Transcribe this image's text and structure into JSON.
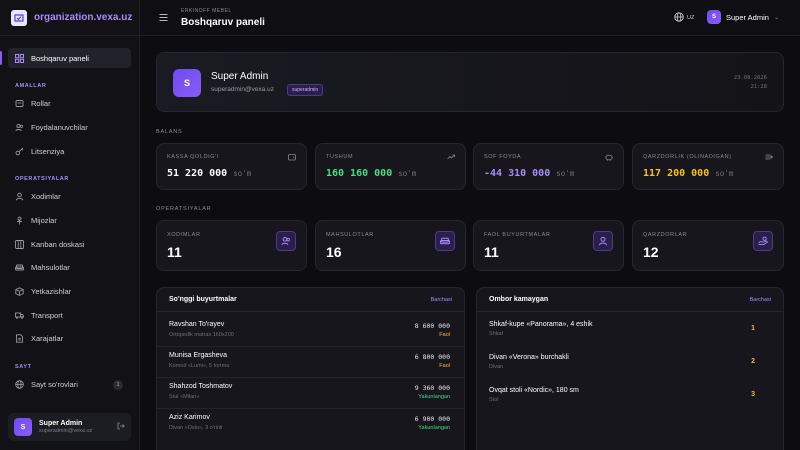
{
  "colors": {
    "accent": "#8b5cf6",
    "green": "#4ade80",
    "purple": "#a78bfa",
    "amber": "#fbbf24"
  },
  "brand": {
    "name": "organization.vexa.uz",
    "icon": "checkmark-shield-icon"
  },
  "sidebar": {
    "dashboard": {
      "label": "Boshqaruv paneli",
      "icon": "dashboard-grid-icon"
    },
    "sections": [
      {
        "title": "AMALLAR",
        "items": [
          {
            "label": "Rollar",
            "icon": "badge-icon"
          },
          {
            "label": "Foydalanuvchilar",
            "icon": "users-icon"
          },
          {
            "label": "Litsenziya",
            "icon": "key-icon"
          }
        ]
      },
      {
        "title": "OPERATSIYALAR",
        "items": [
          {
            "label": "Xodimlar",
            "icon": "user-icon"
          },
          {
            "label": "Mijozlar",
            "icon": "person-icon"
          },
          {
            "label": "Kanban doskasi",
            "icon": "kanban-icon"
          },
          {
            "label": "Mahsulotlar",
            "icon": "sofa-icon"
          },
          {
            "label": "Yetkazishlar",
            "icon": "box-icon"
          },
          {
            "label": "Transport",
            "icon": "truck-icon"
          },
          {
            "label": "Xarajatlar",
            "icon": "document-icon"
          }
        ]
      },
      {
        "title": "SAYT",
        "items": [
          {
            "label": "Sayt so'rovlari",
            "icon": "globe-icon",
            "badge": "1"
          }
        ]
      }
    ],
    "user": {
      "initial": "S",
      "name": "Super Admin",
      "email": "superadmin@vexa.uz"
    }
  },
  "header": {
    "subtitle": "ERKINOFF MEBEL",
    "title": "Boshqaruv paneli",
    "language": "UZ",
    "user": {
      "initial": "S",
      "name": "Super Admin"
    }
  },
  "profile": {
    "initial": "S",
    "name": "Super Admin",
    "email": "superadmin@vexa.uz",
    "role": "superadmin",
    "date": "23.08.2026",
    "time": "21:28"
  },
  "balance": {
    "label": "BALANS",
    "cards": [
      {
        "label": "KASSA QOLDIG'I",
        "value": "51 220 000",
        "unit": "so'm",
        "color": "#ffffff",
        "icon": "wallet-icon"
      },
      {
        "label": "TUSHUM",
        "value": "160 160 000",
        "unit": "so'm",
        "color": "#4ade80",
        "icon": "trend-up-icon"
      },
      {
        "label": "SOF FOYDA",
        "value": "-44 310 000",
        "unit": "so'm",
        "color": "#a78bfa",
        "icon": "piggy-bank-icon"
      },
      {
        "label": "QARZDORLIK (OLINADIGAN)",
        "value": "117 200 000",
        "unit": "so'm",
        "color": "#fbbf24",
        "icon": "cash-icon"
      }
    ]
  },
  "operations": {
    "label": "OPERATSIYALAR",
    "cards": [
      {
        "label": "XODIMLAR",
        "value": "11",
        "icon": "users-icon"
      },
      {
        "label": "MAHSULOTLAR",
        "value": "16",
        "icon": "sofa-icon"
      },
      {
        "label": "FAOL BUYURTMALAR",
        "value": "11",
        "icon": "user-icon"
      },
      {
        "label": "QARZDORLAR",
        "value": "12",
        "icon": "hand-coins-icon"
      }
    ]
  },
  "orders": {
    "title": "So'nggi buyurtmalar",
    "link": "Barchasi",
    "rows": [
      {
        "name": "Ravshan To'rayev",
        "sub": "Ortopedik matras 160x200",
        "amount": "8 600 000",
        "status": "Faol",
        "status_color": "#fbbf24"
      },
      {
        "name": "Munisa Ergasheva",
        "sub": "Komod «Lumi», 5 tortma",
        "amount": "6 800 000",
        "status": "Faol",
        "status_color": "#fbbf24"
      },
      {
        "name": "Shahzod Toshmatov",
        "sub": "Stul «Milan»",
        "amount": "9 360 000",
        "status": "Yakunlangan",
        "status_color": "#4ade80"
      },
      {
        "name": "Aziz Karimov",
        "sub": "Divan «Oslo», 3 o'rinli",
        "amount": "6 900 000",
        "status": "Yakunlangan",
        "status_color": "#4ade80"
      }
    ]
  },
  "stock": {
    "title": "Ombor kamaygan",
    "link": "Barchasi",
    "rows": [
      {
        "name": "Shkaf-kupe «Panorama», 4 eshik",
        "sub": "Shkaf",
        "qty": "1"
      },
      {
        "name": "Divan «Verona» burchakli",
        "sub": "Divan",
        "qty": "2"
      },
      {
        "name": "Ovqat stoli «Nordic», 180 sm",
        "sub": "Stol",
        "qty": "3"
      }
    ]
  }
}
